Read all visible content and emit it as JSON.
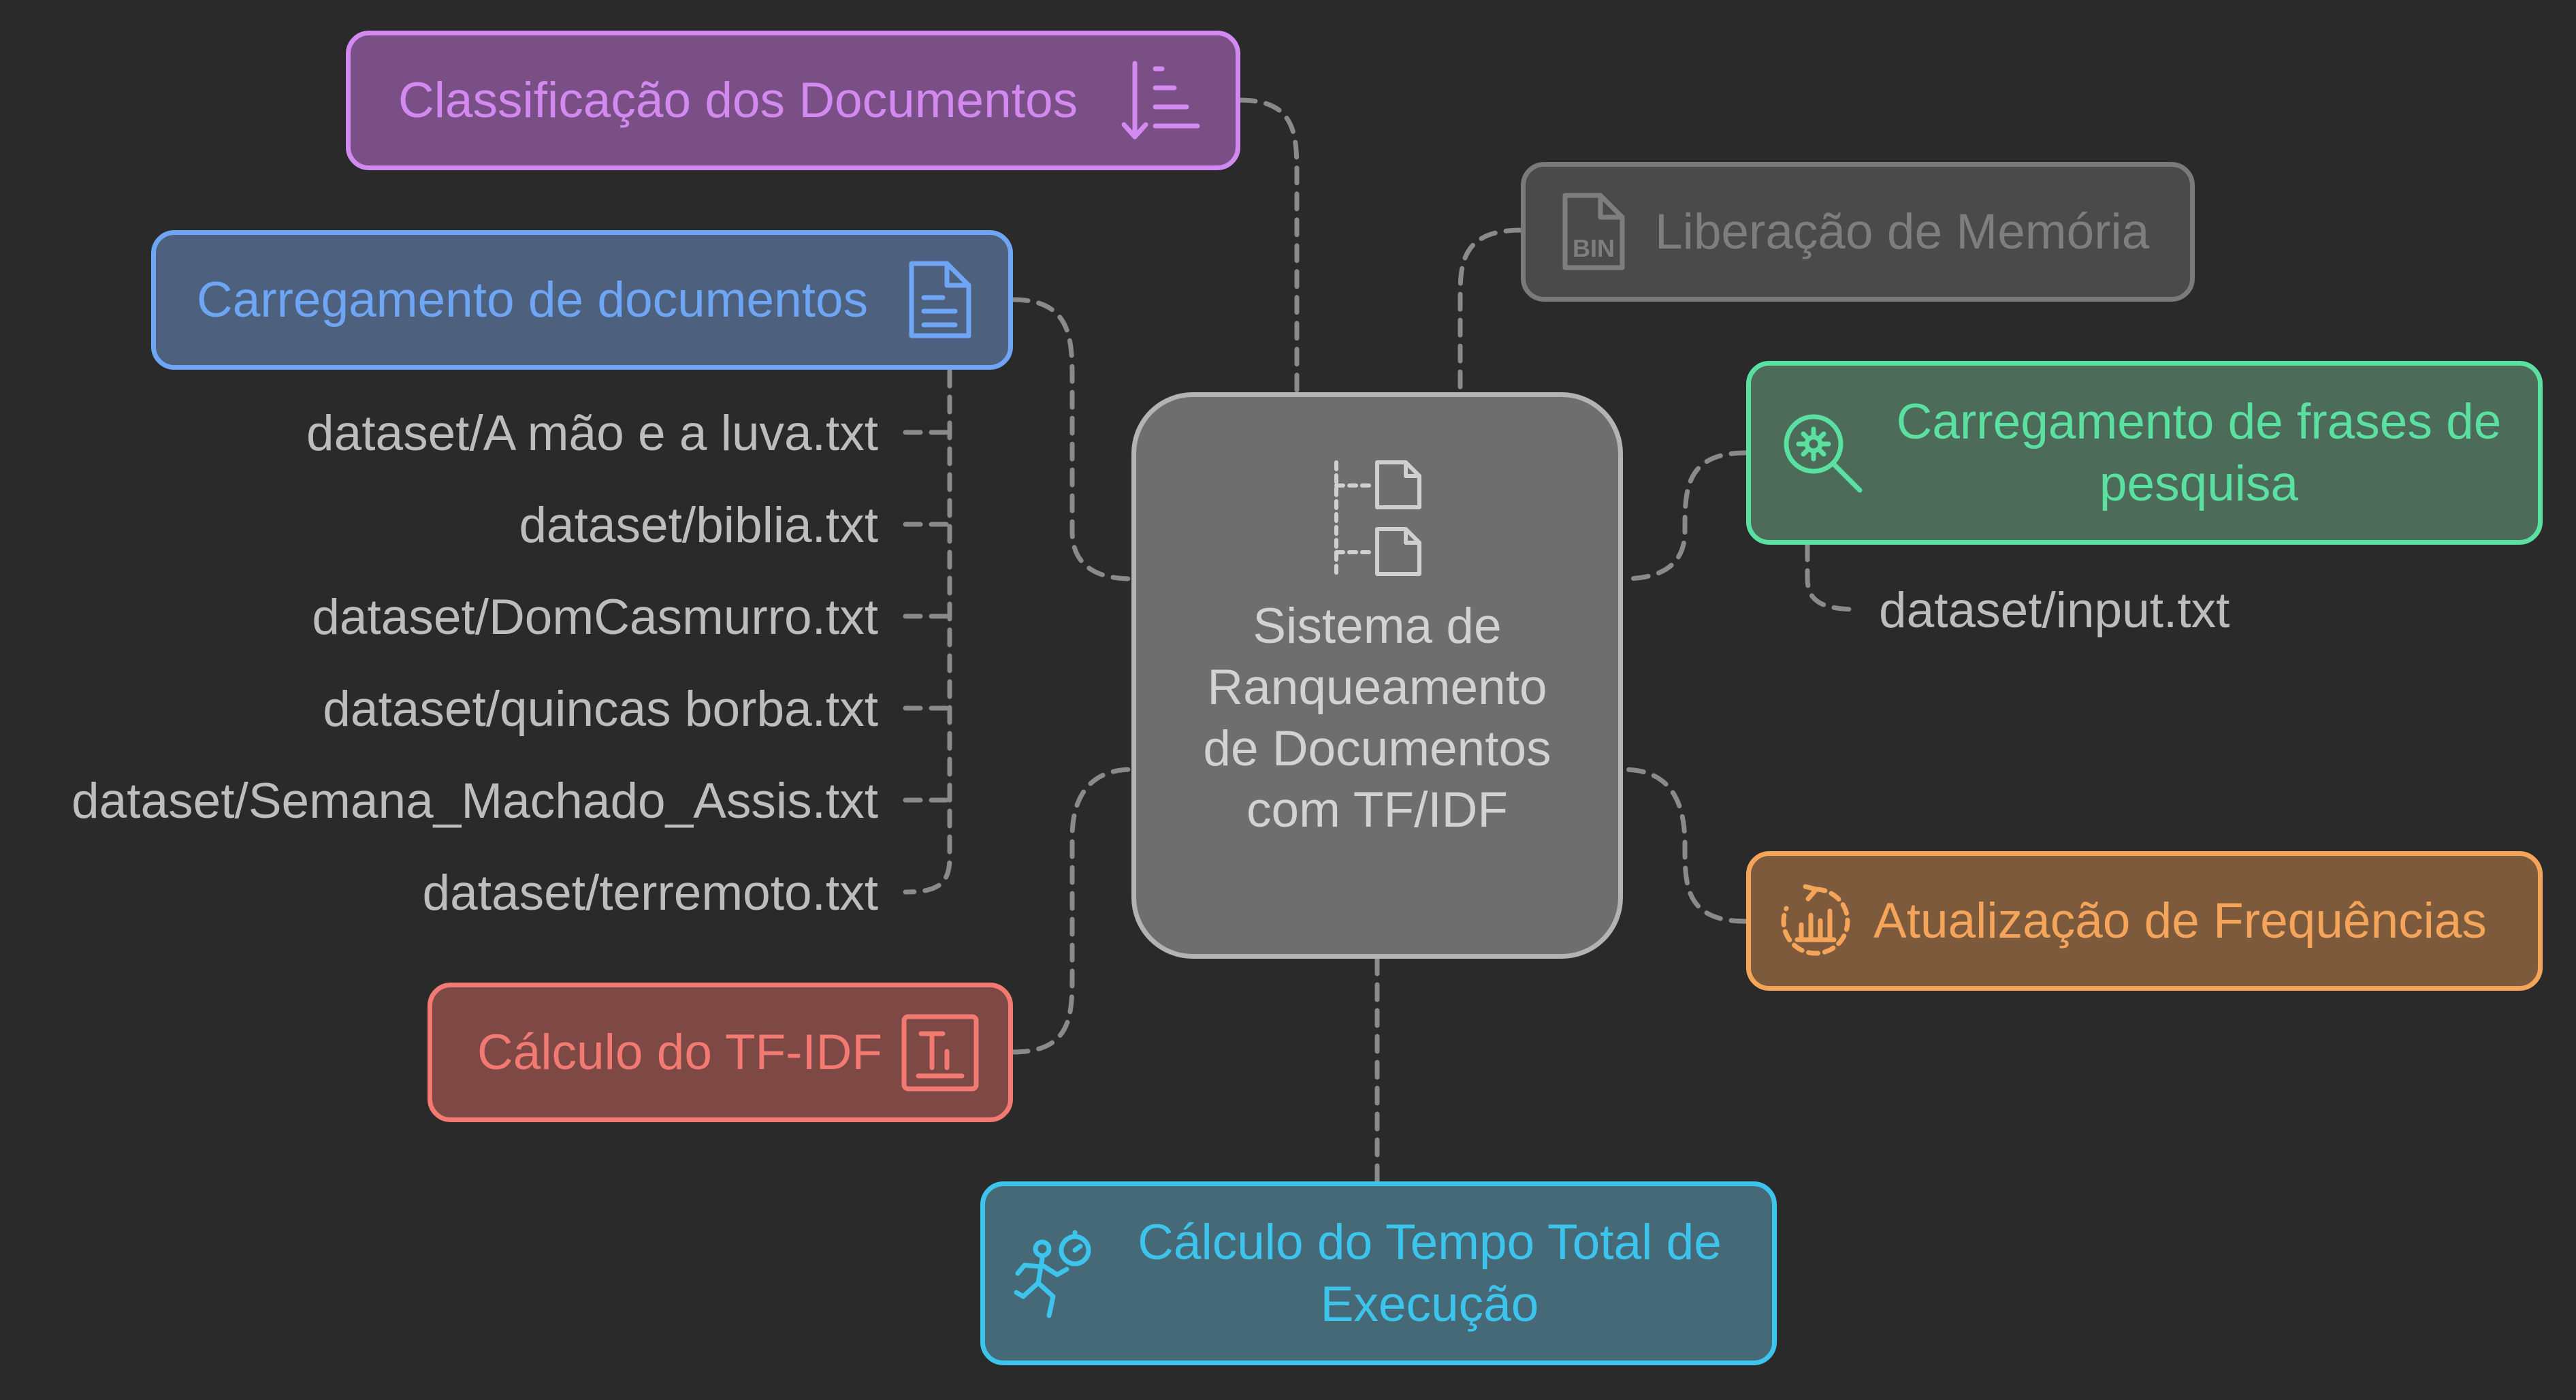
{
  "diagram": {
    "center": {
      "label": "Sistema de Ranqueamento de Documentos com TF/IDF",
      "icon": "documents-tree-icon"
    },
    "nodes": {
      "classificacao": {
        "label": "Classificação dos Documentos",
        "icon": "sort-descending-icon",
        "color": "#d28af0",
        "fill": "#7a4f86"
      },
      "carregamento_docs": {
        "label": "Carregamento de documentos",
        "icon": "document-text-icon",
        "color": "#6ea6f5",
        "fill": "#4d607e"
      },
      "liberacao": {
        "label": "Liberação de Memória",
        "icon": "binary-file-icon",
        "color": "#7a7a7a",
        "fill": "#4a4a4a"
      },
      "frases": {
        "label": "Carregamento de frases de pesquisa",
        "icon": "search-settings-icon",
        "color": "#5ae0a0",
        "fill": "#4c6b58"
      },
      "frequencias": {
        "label": "Atualização de Frequências",
        "icon": "refresh-chart-icon",
        "color": "#f5a55a",
        "fill": "#7e5a3d"
      },
      "tfidf": {
        "label": "Cálculo do TF-IDF",
        "icon": "text-format-icon",
        "color": "#f27a72",
        "fill": "#7e4845"
      },
      "tempo": {
        "label": "Cálculo do Tempo Total de Execução",
        "icon": "running-stopwatch-icon",
        "color": "#3dc4ec",
        "fill": "#456976"
      }
    },
    "document_files": [
      "dataset/A mão e a luva.txt",
      "dataset/biblia.txt",
      "dataset/DomCasmurro.txt",
      "dataset/quincas borba.txt",
      "dataset/Semana_Machado_Assis.txt",
      "dataset/terremoto.txt"
    ],
    "input_file": "dataset/input.txt"
  }
}
